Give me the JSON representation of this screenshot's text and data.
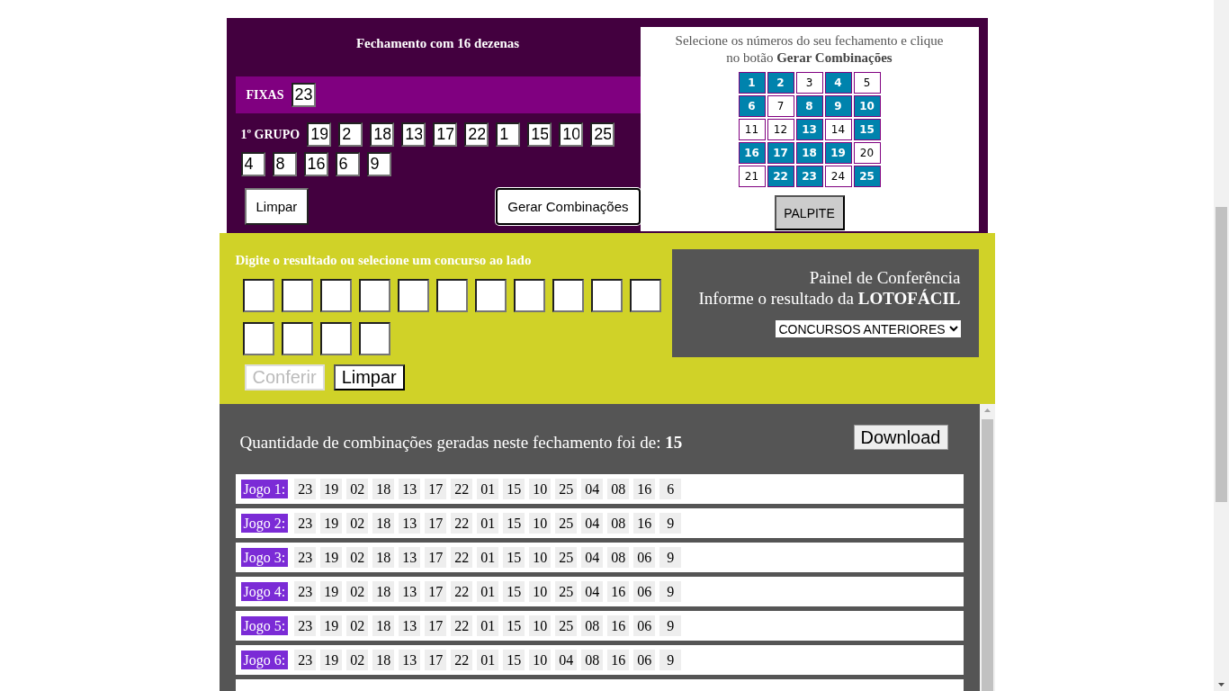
{
  "closing": {
    "title": "Fechamento com 16 dezenas",
    "fixed": {
      "label": "FIXAS",
      "values": [
        "23"
      ]
    },
    "group": {
      "label": "1º GRUPO",
      "values": [
        "19",
        "2",
        "18",
        "13",
        "17",
        "22",
        "1",
        "15",
        "10",
        "25",
        "4",
        "8",
        "16",
        "6",
        "9"
      ]
    },
    "buttons": {
      "clear": "Limpar",
      "generate": "Gerar Combinações"
    }
  },
  "picker": {
    "instructions": "Selecione os números do seu fechamento e clique no botão **Gerar Combinações**",
    "numbers": [
      {
        "label": "1",
        "selected": true
      },
      {
        "label": "2",
        "selected": true
      },
      {
        "label": "3",
        "selected": false
      },
      {
        "label": "4",
        "selected": true
      },
      {
        "label": "5",
        "selected": false
      },
      {
        "label": "6",
        "selected": true
      },
      {
        "label": "7",
        "selected": false
      },
      {
        "label": "8",
        "selected": true
      },
      {
        "label": "9",
        "selected": true
      },
      {
        "label": "10",
        "selected": true
      },
      {
        "label": "11",
        "selected": false
      },
      {
        "label": "12",
        "selected": false
      },
      {
        "label": "13",
        "selected": true
      },
      {
        "label": "14",
        "selected": false
      },
      {
        "label": "15",
        "selected": true
      },
      {
        "label": "16",
        "selected": true
      },
      {
        "label": "17",
        "selected": true
      },
      {
        "label": "18",
        "selected": true
      },
      {
        "label": "19",
        "selected": true
      },
      {
        "label": "20",
        "selected": false
      },
      {
        "label": "21",
        "selected": false
      },
      {
        "label": "22",
        "selected": true
      },
      {
        "label": "23",
        "selected": true
      },
      {
        "label": "24",
        "selected": false
      },
      {
        "label": "25",
        "selected": true
      }
    ],
    "button": "PALPITE"
  },
  "check": {
    "prompt": "Digite o resultado ou selecione um concurso ao lado",
    "buttons": [
      {
        "label": "Conferir",
        "disabled": true
      },
      {
        "label": "Limpar",
        "disabled": false
      }
    ],
    "panel": {
      "title": "Painel de Conferência",
      "subtitle": "Informe o resultado da **LOTOFÁCIL**",
      "select": "CONCURSOS ANTERIORES"
    }
  },
  "results": {
    "summary": "Quantidade de combinações geradas neste fechamento foi de: **15**",
    "download": "Download",
    "games": [
      {
        "label": "Jogo 1:",
        "numbers": [
          "23",
          "19",
          "02",
          "18",
          "13",
          "17",
          "22",
          "01",
          "15",
          "10",
          "25",
          "04",
          "08",
          "16",
          "6"
        ]
      },
      {
        "label": "Jogo 2:",
        "numbers": [
          "23",
          "19",
          "02",
          "18",
          "13",
          "17",
          "22",
          "01",
          "15",
          "10",
          "25",
          "04",
          "08",
          "16",
          "9"
        ]
      },
      {
        "label": "Jogo 3:",
        "numbers": [
          "23",
          "19",
          "02",
          "18",
          "13",
          "17",
          "22",
          "01",
          "15",
          "10",
          "25",
          "04",
          "08",
          "06",
          "9"
        ]
      },
      {
        "label": "Jogo 4:",
        "numbers": [
          "23",
          "19",
          "02",
          "18",
          "13",
          "17",
          "22",
          "01",
          "15",
          "10",
          "25",
          "04",
          "16",
          "06",
          "9"
        ]
      },
      {
        "label": "Jogo 5:",
        "numbers": [
          "23",
          "19",
          "02",
          "18",
          "13",
          "17",
          "22",
          "01",
          "15",
          "10",
          "25",
          "08",
          "16",
          "06",
          "9"
        ]
      },
      {
        "label": "Jogo 6:",
        "numbers": [
          "23",
          "19",
          "02",
          "18",
          "13",
          "17",
          "22",
          "01",
          "15",
          "10",
          "04",
          "08",
          "16",
          "06",
          "9"
        ]
      }
    ]
  }
}
